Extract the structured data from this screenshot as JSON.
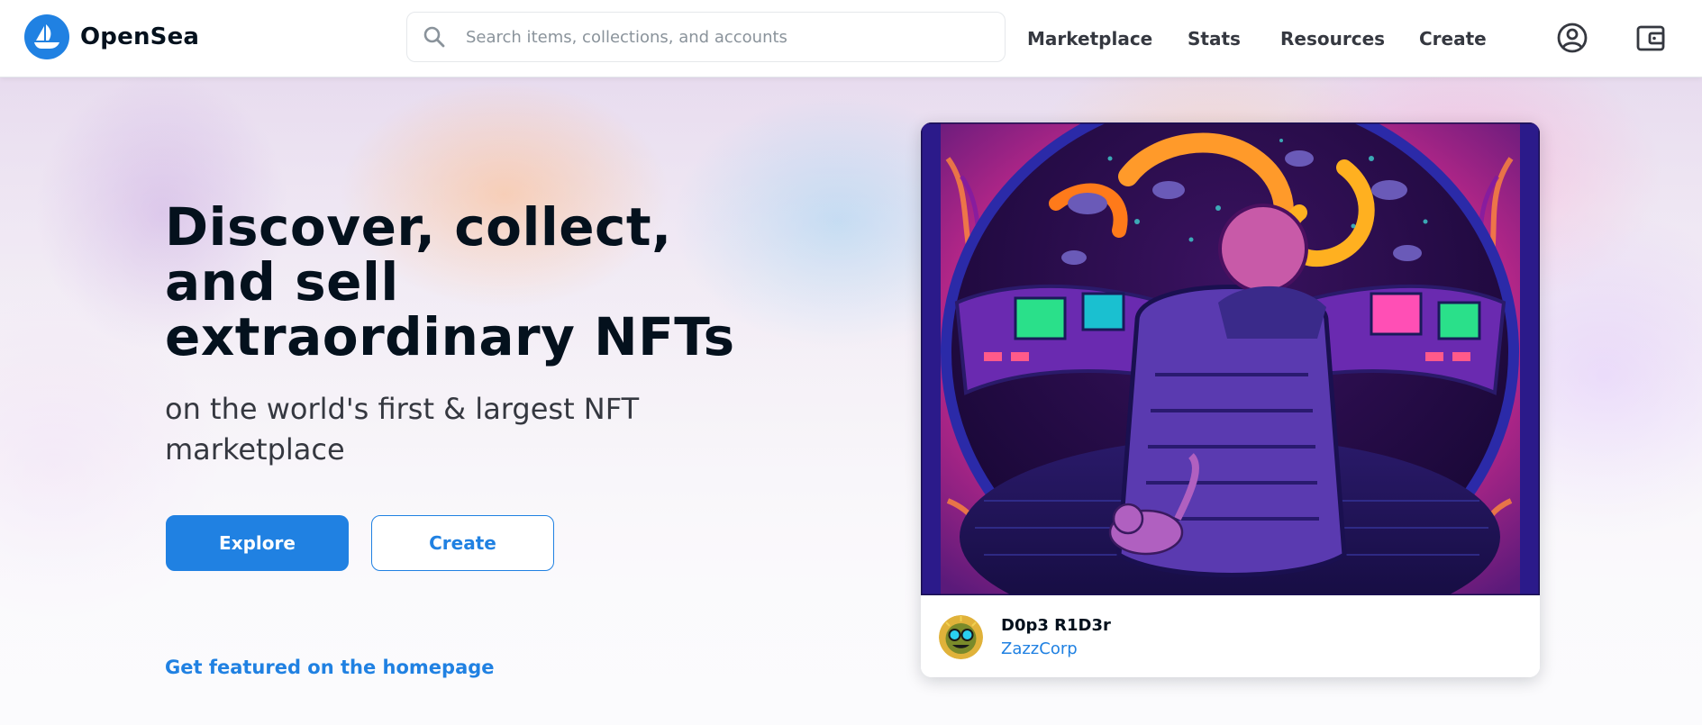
{
  "header": {
    "logo_text": "OpenSea",
    "search": {
      "placeholder": "Search items, collections, and accounts",
      "value": ""
    },
    "nav": [
      {
        "label": "Marketplace"
      },
      {
        "label": "Stats"
      },
      {
        "label": "Resources"
      },
      {
        "label": "Create"
      }
    ],
    "icons": [
      "account-icon",
      "wallet-icon"
    ]
  },
  "hero": {
    "headline": "Discover, collect, and sell extraordinary NFTs",
    "subline": "on the world's first & largest NFT marketplace",
    "explore_label": "Explore",
    "create_label": "Create",
    "featured_link": "Get featured on the homepage"
  },
  "featured_card": {
    "name": "D0p3 R1D3r",
    "collection": "ZazzCorp"
  },
  "colors": {
    "brand": "#2081e2",
    "text_primary": "#04111d",
    "text_secondary": "#353840",
    "border": "#e5e8eb"
  }
}
